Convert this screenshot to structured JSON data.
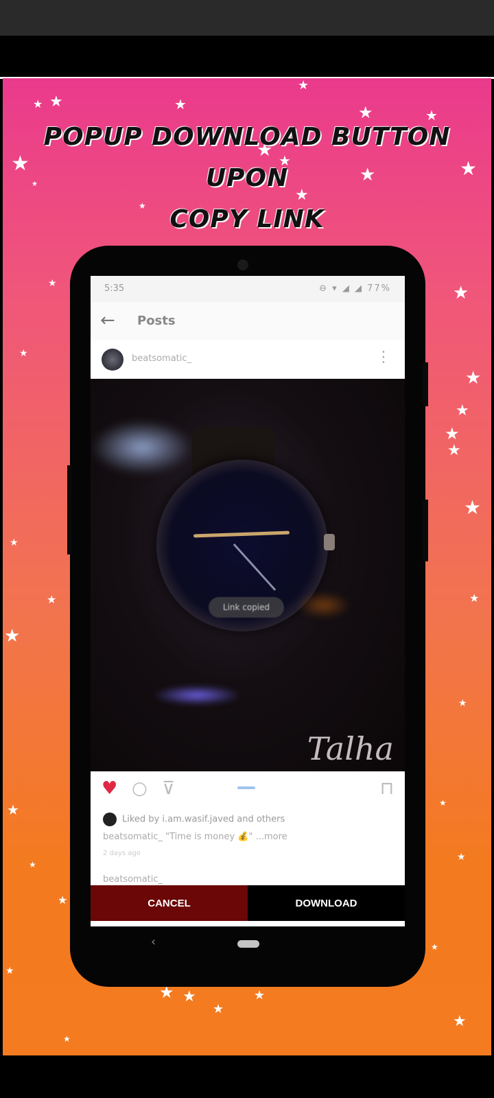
{
  "headline": {
    "line1": "Popup Download Button Upon",
    "line2": "Copy Link"
  },
  "phone": {
    "status_bar": {
      "time": "5:35",
      "icons": "⊖ ▾ ◢ ◢ 77%"
    },
    "app_bar": {
      "title": "Posts",
      "back_icon": "arrow-left-icon"
    },
    "post": {
      "username": "beatsomatic_",
      "watermark": "Talha",
      "toast": "Link copied",
      "liked_by": "Liked by i.am.wasif.javed and others",
      "caption": "beatsomatic_ \"Time is money 💰\" ...more",
      "time_ago": "2 days ago",
      "next_username": "beatsomatic_"
    },
    "popup": {
      "cancel_label": "CANCEL",
      "download_label": "DOWNLOAD"
    },
    "nav": {
      "back_glyph": "‹"
    }
  },
  "colors": {
    "cancel_bg": "#6b0707",
    "download_bg": "#000000",
    "heart": "#e02844"
  }
}
